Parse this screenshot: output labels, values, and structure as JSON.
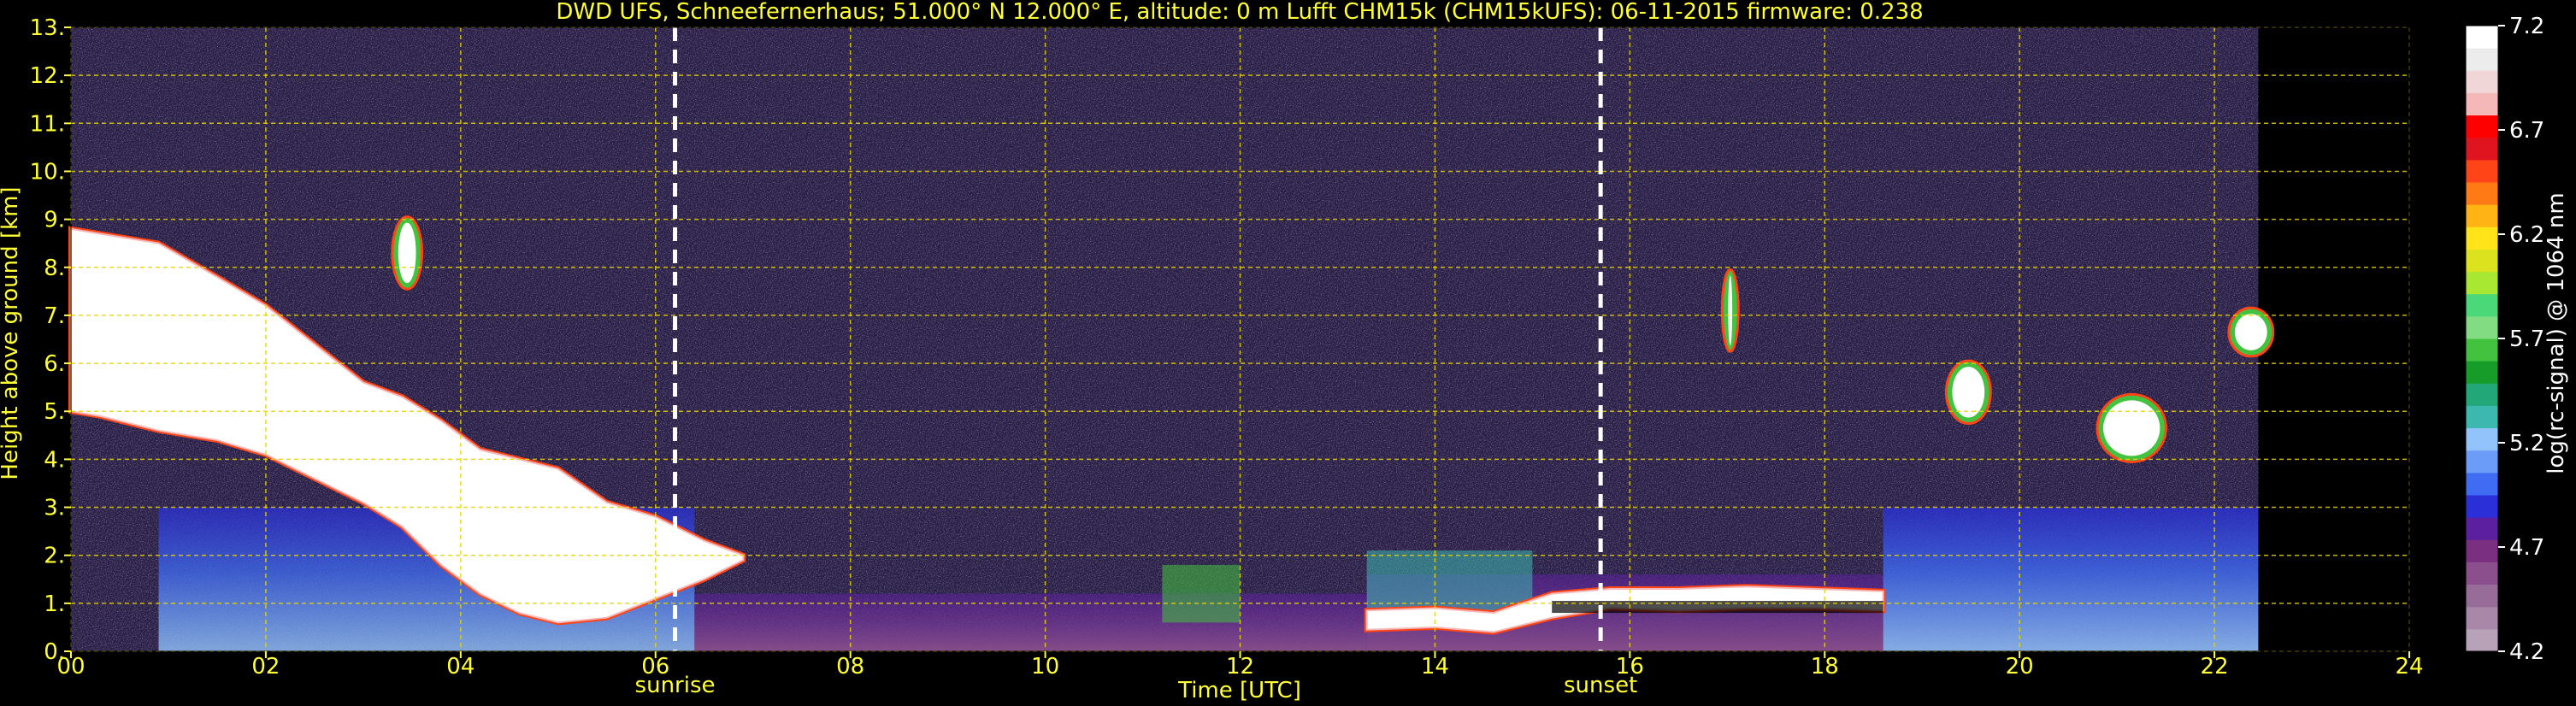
{
  "chart_data": {
    "type": "heatmap",
    "title": "DWD UFS, Schneefernerhaus; 51.000° N 12.000° E, altitude: 0 m    Lufft CHM15k (CHM15kUFS): 06-11-2015    firmware: 0.238",
    "xlabel": "Time [UTC]",
    "ylabel": "Height above ground [km]",
    "xlim": [
      0,
      24
    ],
    "ylim": [
      0,
      13
    ],
    "x_ticks": [
      "00",
      "02",
      "04",
      "06",
      "08",
      "10",
      "12",
      "14",
      "16",
      "18",
      "20",
      "22",
      "24"
    ],
    "y_ticks": [
      "0.",
      "1.",
      "2.",
      "3.",
      "4.",
      "5.",
      "6.",
      "7.",
      "8.",
      "9.",
      "10.",
      "11.",
      "12.",
      "13."
    ],
    "grid": true,
    "data_end_hour": 22.45,
    "markers": [
      {
        "label": "sunrise",
        "x": 6.2
      },
      {
        "label": "sunset",
        "x": 15.7
      }
    ],
    "colorbar": {
      "label": "log(rc-signal) @ 1064 nm",
      "min": 4.2,
      "max": 7.2,
      "ticks": [
        "4.2",
        "4.7",
        "5.2",
        "5.7",
        "6.2",
        "6.7",
        "7.2"
      ],
      "colors": [
        "#b8a2b8",
        "#a887a8",
        "#986c98",
        "#8a4f8c",
        "#7b2f80",
        "#5c1fa0",
        "#2a2fd8",
        "#3f6cf2",
        "#6b9cf8",
        "#93c3fb",
        "#3cb8b0",
        "#22a878",
        "#169c28",
        "#42c23e",
        "#82dc82",
        "#4ad878",
        "#a8e832",
        "#dce21e",
        "#ffe41a",
        "#ffb414",
        "#ff7a14",
        "#ff4418",
        "#e0141e",
        "#ff0000",
        "#f4b8b8",
        "#f0d6d6",
        "#ececec",
        "#ffffff"
      ]
    },
    "cloud_layers": [
      {
        "x": [
          0.0,
          0.3,
          0.9,
          1.5,
          2.0,
          2.5,
          3.0,
          3.4,
          3.8,
          4.2,
          4.6,
          5.0,
          5.5,
          6.0,
          6.5,
          6.9
        ],
        "top": [
          8.8,
          8.7,
          8.5,
          7.8,
          7.2,
          6.4,
          5.6,
          5.3,
          4.8,
          4.2,
          4.0,
          3.8,
          3.1,
          2.8,
          2.3,
          2.0
        ],
        "base": [
          5.0,
          4.9,
          4.6,
          4.4,
          4.1,
          3.6,
          3.1,
          2.6,
          1.8,
          1.2,
          0.8,
          0.6,
          0.7,
          1.1,
          1.5,
          1.9
        ]
      },
      {
        "x": [
          13.3,
          14.0,
          14.6,
          15.2,
          15.8,
          16.5,
          17.2,
          17.9,
          18.6
        ],
        "top": [
          0.85,
          0.9,
          0.8,
          1.2,
          1.3,
          1.3,
          1.35,
          1.3,
          1.25
        ],
        "base": [
          0.45,
          0.5,
          0.4,
          0.7,
          0.9,
          0.85,
          0.9,
          0.9,
          0.85
        ]
      }
    ],
    "cloud_patches": [
      {
        "x": 3.35,
        "y": 7.6,
        "w": 0.2,
        "h": 1.4
      },
      {
        "x": 17.0,
        "y": 6.3,
        "w": 0.06,
        "h": 1.6
      },
      {
        "x": 19.3,
        "y": 4.8,
        "w": 0.35,
        "h": 1.2
      },
      {
        "x": 20.85,
        "y": 4.0,
        "w": 0.6,
        "h": 1.3
      },
      {
        "x": 22.2,
        "y": 6.2,
        "w": 0.35,
        "h": 0.9
      }
    ]
  }
}
